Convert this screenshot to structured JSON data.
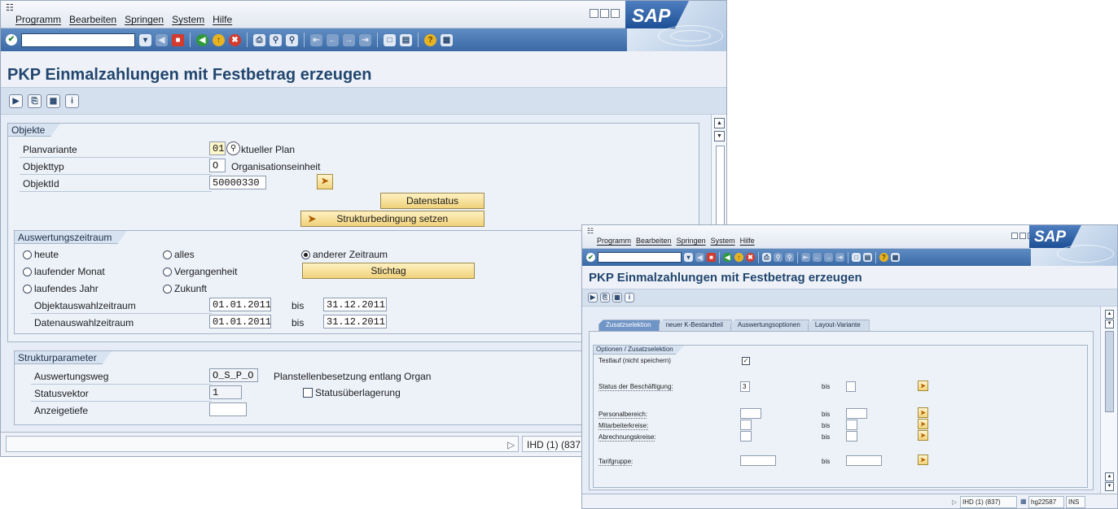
{
  "colors": {
    "toolbar": "#4a7ab4",
    "title": "#22466f",
    "content_bg": "#e7edf6",
    "button_yellow": "#f0d27a"
  },
  "sap_logo": "SAP",
  "menu": [
    "Programm",
    "Bearbeiten",
    "Springen",
    "System",
    "Hilfe"
  ],
  "window1": {
    "title": "PKP Einmalzahlungen mit Festbetrag erzeugen",
    "objekte": {
      "title": "Objekte",
      "planvariante_label": "Planvariante",
      "planvariante_value": "01",
      "planvariante_text": "ktueller Plan",
      "objekttyp_label": "Objekttyp",
      "objekttyp_value": "O",
      "objekttyp_text": "Organisationseinheit",
      "objektid_label": "ObjektId",
      "objektid_value": "50000330",
      "datenstatus_button": "Datenstatus",
      "strukturbedingung_button": "Strukturbedingung setzen"
    },
    "auswertungszeitraum": {
      "title": "Auswertungszeitraum",
      "radio_heute": "heute",
      "radio_alles": "alles",
      "radio_anderer": "anderer Zeitraum",
      "radio_monat": "laufender Monat",
      "radio_vergangenheit": "Vergangenheit",
      "radio_jahr": "laufendes Jahr",
      "radio_zukunft": "Zukunft",
      "stichtag_button": "Stichtag",
      "objektauswahl_label": "Objektauswahlzeitraum",
      "objektauswahl_from": "01.01.2011",
      "objektauswahl_to": "31.12.2011",
      "datenauswahl_label": "Datenauswahlzeitraum",
      "datenauswahl_from": "01.01.2011",
      "datenauswahl_to": "31.12.2011",
      "bis": "bis"
    },
    "strukturparameter": {
      "title": "Strukturparameter",
      "auswertungsweg_label": "Auswertungsweg",
      "auswertungsweg_value": "O_S_P_O",
      "auswertungsweg_text": "Planstellenbesetzung entlang Organ",
      "statusvektor_label": "Statusvektor",
      "statusvektor_value": "1",
      "statusueberlagerung": "Statusüberlagerung",
      "anzeigetiefe_label": "Anzeigetiefe",
      "anzeigetiefe_value": ""
    },
    "status": {
      "system": "IHD (1) (837"
    }
  },
  "window2": {
    "title": "PKP Einmalzahlungen mit Festbetrag erzeugen",
    "tabs": [
      "Zusatzselektion",
      "neuer K-Bestandteil",
      "Auswertungsoptionen",
      "Layout-Variante"
    ],
    "active_tab": 0,
    "group_title": "Optionen / Zusatzselektion",
    "testlauf_label": "Testlauf (nicht speichern)",
    "testlauf_checked": "✓",
    "status_label": "Status der Beschäftigung:",
    "status_value": "3",
    "personalbereich_label": "Personalbereich:",
    "mitarbeiterkreise_label": "Mitarbeiterkreise:",
    "abrechnungskreise_label": "Abrechnungskreise:",
    "tarifgruppe_label": "Tarifgruppe:",
    "bis": "bis",
    "status": {
      "system": "IHD (1) (837)",
      "user": "hg22587",
      "mode": "INS"
    }
  }
}
